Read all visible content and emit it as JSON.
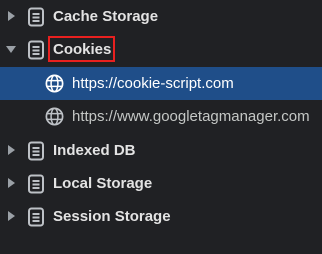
{
  "tree": {
    "items": [
      {
        "label": "Cache Storage",
        "expanded": false,
        "icon": "database-icon"
      },
      {
        "label": "Cookies",
        "expanded": true,
        "icon": "database-icon",
        "highlighted": true,
        "children": [
          {
            "label": "https://cookie-script.com",
            "icon": "globe-icon",
            "selected": true
          },
          {
            "label": "https://www.googletagmanager.com",
            "icon": "globe-icon",
            "selected": false
          }
        ]
      },
      {
        "label": "Indexed DB",
        "expanded": false,
        "icon": "database-icon"
      },
      {
        "label": "Local Storage",
        "expanded": false,
        "icon": "database-icon"
      },
      {
        "label": "Session Storage",
        "expanded": false,
        "icon": "database-icon"
      }
    ]
  },
  "colors": {
    "background": "#202124",
    "selected_row": "#1f4e89",
    "text": "#e3e3e3",
    "icon": "#bdc1c6",
    "highlight_border": "#e8201f"
  }
}
